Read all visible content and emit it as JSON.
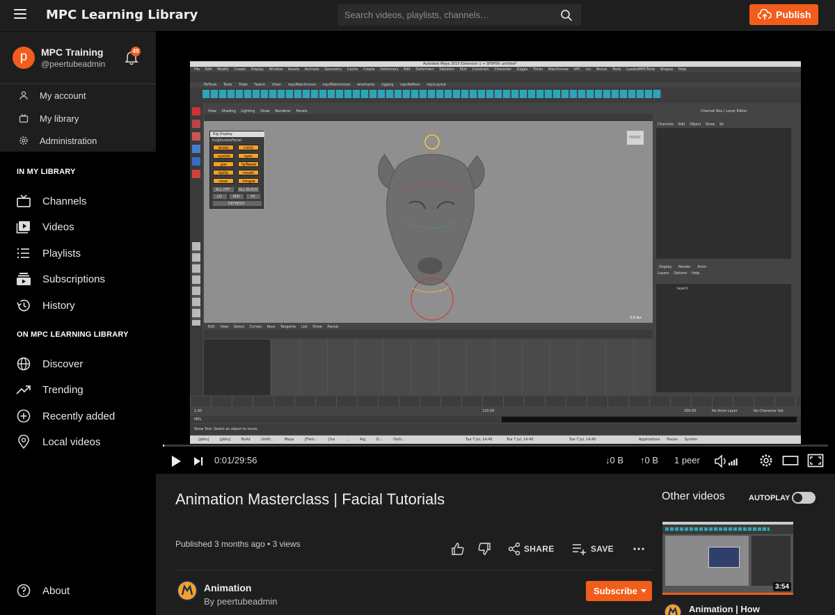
{
  "app": {
    "title": "MPC Learning Library",
    "search_placeholder": "Search videos, playlists, channels…",
    "publish_label": "Publish"
  },
  "user": {
    "initial": "p",
    "name": "MPC Training",
    "handle": "@peertubeadmin",
    "notifications": "49",
    "menu": [
      {
        "label": "My account",
        "icon": "person-icon"
      },
      {
        "label": "My library",
        "icon": "library-icon"
      },
      {
        "label": "Administration",
        "icon": "cog-icon"
      }
    ]
  },
  "sidebar": {
    "section_library": "IN MY LIBRARY",
    "library_items": [
      {
        "label": "Channels",
        "icon": "channels-icon"
      },
      {
        "label": "Videos",
        "icon": "videos-icon"
      },
      {
        "label": "Playlists",
        "icon": "playlists-icon"
      },
      {
        "label": "Subscriptions",
        "icon": "subscriptions-icon"
      },
      {
        "label": "History",
        "icon": "history-icon"
      }
    ],
    "section_site": "ON MPC LEARNING LIBRARY",
    "site_items": [
      {
        "label": "Discover",
        "icon": "globe-icon"
      },
      {
        "label": "Trending",
        "icon": "trending-icon"
      },
      {
        "label": "Recently added",
        "icon": "plus-circle-icon"
      },
      {
        "label": "Local videos",
        "icon": "location-icon"
      }
    ],
    "about_label": "About"
  },
  "player": {
    "current_time": "0:01",
    "duration": "29:56",
    "time_display": "0:01/29:56",
    "progress_fraction": 0.0006,
    "download_rate": "0 B",
    "upload_rate": "0 B",
    "peers": "1 peer",
    "screen": {
      "window_title": "Autodesk Maya 2015 Extension 1 + SP5P09: untitled*",
      "rig_panel_title": "Rig Display",
      "rig_panel_sub": "liv@lionessFacial",
      "rig_buttons": [
        "brows",
        "cntrlz",
        "eyelids",
        "eyes",
        "jaw",
        "lipTweak",
        "lipZip",
        "mouth",
        "nose",
        "tongue"
      ],
      "rig_bottom": [
        "ALL OFF",
        "ALL BLOCK",
        "LO",
        "MID",
        "HI",
        "REFRESH"
      ],
      "channel_box_title": "Channel Box / Layer Editor",
      "channel_menu": [
        "Channels",
        "Edit",
        "Object",
        "Show",
        "Sh"
      ],
      "layer_tabs": [
        "Display",
        "Render",
        "Anim"
      ],
      "layer_menu": [
        "Layers",
        "Options",
        "Help"
      ],
      "layer_name": "layer1",
      "fps": "3.8 fps",
      "view_cube": "FRONT",
      "graph_menu": [
        "Edit",
        "View",
        "Select",
        "Curves",
        "Keys",
        "Tangents",
        "List",
        "Show",
        "Panels"
      ],
      "viewport_menu": [
        "View",
        "Shading",
        "Lighting",
        "Show",
        "Renderer",
        "Panels"
      ],
      "main_menu": [
        "File",
        "Edit",
        "Modify",
        "Create",
        "Display",
        "Window",
        "Assets",
        "Animate",
        "Geometry Cache",
        "Create Deformers",
        "Edit Deformers",
        "Skeleton",
        "Skin",
        "Constrain",
        "Character",
        "Giggle",
        "Tricks",
        "Matchmove",
        "VPC",
        "Inc",
        "Bonus Tools",
        "LoadedMPCTools",
        "Shapes",
        "Help"
      ],
      "shelf_tabs": [
        "PbTools",
        "Tools",
        "Trials",
        "Taskm",
        "VGen",
        "mpcMatchmove",
        "mpcMatchmove",
        "wireframe",
        "rigging",
        "mpcRefiner",
        "mpcLayout"
      ],
      "time_start": "1.00",
      "time_end": "120.00",
      "range_end": "200.00",
      "anim_layer": "No Anim Layer",
      "char_set": "No Character Set",
      "mel_label": "MEL",
      "help_line": "Show Tool: Select an object to move.",
      "taskbar_items": [
        "[pbtu]",
        "[pbtu]",
        "Build",
        "Untitl...",
        "Maya",
        "[Flein...",
        "[Ins ...",
        "Rig D...",
        "Outli..."
      ],
      "taskbar_clock": "Tue 7 Jul, 14:40",
      "taskbar_right": [
        "Applications",
        "Places",
        "System"
      ]
    }
  },
  "video": {
    "title": "Animation Masterclass | Facial Tutorials",
    "published": "Published 3 months ago • 3 views",
    "actions": {
      "share": "SHARE",
      "save": "SAVE"
    },
    "channel": {
      "name": "Animation",
      "by": "By peertubeadmin",
      "subscribe": "Subscribe"
    }
  },
  "recommendations": {
    "title": "Other videos",
    "autoplay_label": "AUTOPLAY",
    "autoplay_on": false,
    "items": [
      {
        "title": "Animation | How",
        "duration": "3:54"
      }
    ]
  },
  "colors": {
    "accent": "#f25d1b",
    "topbar": "#1e1e1e",
    "sidebar": "#000000",
    "info_bg": "#1e1e1e"
  }
}
